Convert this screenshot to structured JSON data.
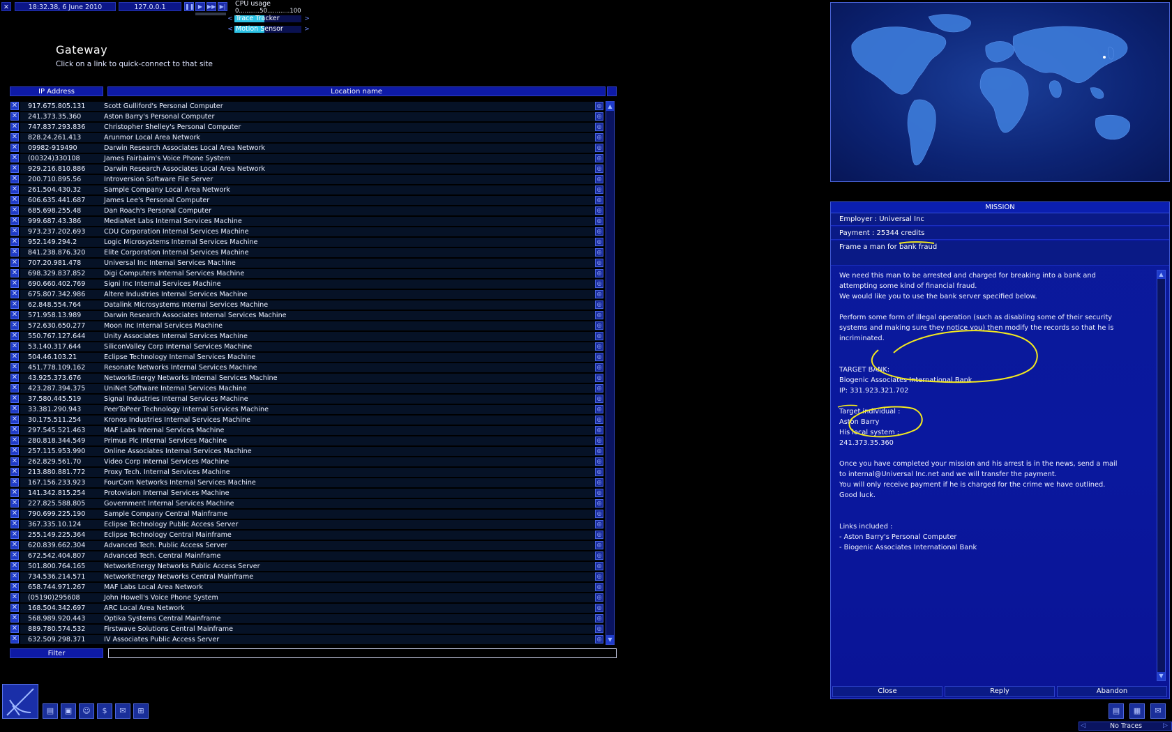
{
  "topbar": {
    "datetime": "18:32.38, 6 June 2010",
    "ip": "127.0.0.1",
    "cpu_label": "CPU usage",
    "cpu_scale": "0...........50............100",
    "bars": [
      {
        "label": "Trace Tracker",
        "fill": 0.45
      },
      {
        "label": "Motion Sensor",
        "fill": 0.45
      }
    ]
  },
  "gateway": {
    "title": "Gateway",
    "subtitle": "Click on a link to quick-connect to that site",
    "col_ip": "IP Address",
    "col_location": "Location name",
    "filter_label": "Filter",
    "filter_value": "",
    "rows": [
      {
        "ip": "917.675.805.131",
        "name": "Scott Gulliford's Personal Computer"
      },
      {
        "ip": "241.373.35.360",
        "name": "Aston Barry's Personal Computer"
      },
      {
        "ip": "747.837.293.836",
        "name": "Christopher Shelley's Personal Computer"
      },
      {
        "ip": "828.24.261.413",
        "name": "Arunmor Local Area Network"
      },
      {
        "ip": "09982-919490",
        "name": "Darwin Research Associates Local Area Network"
      },
      {
        "ip": "(00324)330108",
        "name": "James Fairbairn's Voice Phone System"
      },
      {
        "ip": "929.216.810.886",
        "name": "Darwin Research Associates Local Area Network"
      },
      {
        "ip": "200.710.895.56",
        "name": "Introversion Software File Server"
      },
      {
        "ip": "261.504.430.32",
        "name": "Sample Company Local Area Network"
      },
      {
        "ip": "606.635.441.687",
        "name": "James Lee's Personal Computer"
      },
      {
        "ip": "685.698.255.48",
        "name": "Dan Roach's Personal Computer"
      },
      {
        "ip": "999.687.43.386",
        "name": "MediaNet Labs Internal Services Machine"
      },
      {
        "ip": "973.237.202.693",
        "name": "CDU Corporation Internal Services Machine"
      },
      {
        "ip": "952.149.294.2",
        "name": "Logic Microsystems Internal Services Machine"
      },
      {
        "ip": "841.238.876.320",
        "name": "Elite Corporation Internal Services Machine"
      },
      {
        "ip": "707.20.981.478",
        "name": "Universal Inc Internal Services Machine"
      },
      {
        "ip": "698.329.837.852",
        "name": "Digi Computers Internal Services Machine"
      },
      {
        "ip": "690.660.402.769",
        "name": "Signi Inc Internal Services Machine"
      },
      {
        "ip": "675.807.342.986",
        "name": "Altere Industries Internal Services Machine"
      },
      {
        "ip": "62.848.554.764",
        "name": "Datalink Microsystems Internal Services Machine"
      },
      {
        "ip": "571.958.13.989",
        "name": "Darwin Research Associates Internal Services Machine"
      },
      {
        "ip": "572.630.650.277",
        "name": "Moon Inc Internal Services Machine"
      },
      {
        "ip": "550.767.127.644",
        "name": "Unity Associates Internal Services Machine"
      },
      {
        "ip": "53.140.317.644",
        "name": "SiliconValley Corp Internal Services Machine"
      },
      {
        "ip": "504.46.103.21",
        "name": "Eclipse Technology Internal Services Machine"
      },
      {
        "ip": "451.778.109.162",
        "name": "Resonate Networks Internal Services Machine"
      },
      {
        "ip": "43.925.373.676",
        "name": "NetworkEnergy Networks Internal Services Machine"
      },
      {
        "ip": "423.287.394.375",
        "name": "UniNet Software Internal Services Machine"
      },
      {
        "ip": "37.580.445.519",
        "name": "Signal Industries Internal Services Machine"
      },
      {
        "ip": "33.381.290.943",
        "name": "PeerToPeer Technology Internal Services Machine"
      },
      {
        "ip": "30.175.511.254",
        "name": "Kronos Industries Internal Services Machine"
      },
      {
        "ip": "297.545.521.463",
        "name": "MAF Labs Internal Services Machine"
      },
      {
        "ip": "280.818.344.549",
        "name": "Primus Plc Internal Services Machine"
      },
      {
        "ip": "257.115.953.990",
        "name": "Online Associates Internal Services Machine"
      },
      {
        "ip": "262.829.561.70",
        "name": "Video Corp Internal Services Machine"
      },
      {
        "ip": "213.880.881.772",
        "name": "Proxy Tech. Internal Services Machine"
      },
      {
        "ip": "167.156.233.923",
        "name": "FourCom Networks Internal Services Machine"
      },
      {
        "ip": "141.342.815.254",
        "name": "Protovision Internal Services Machine"
      },
      {
        "ip": "227.825.588.805",
        "name": "Government Internal Services Machine"
      },
      {
        "ip": "790.699.225.190",
        "name": "Sample Company Central Mainframe"
      },
      {
        "ip": "367.335.10.124",
        "name": "Eclipse Technology Public Access Server"
      },
      {
        "ip": "255.149.225.364",
        "name": "Eclipse Technology Central Mainframe"
      },
      {
        "ip": "620.839.662.304",
        "name": "Advanced Tech. Public Access Server"
      },
      {
        "ip": "672.542.404.807",
        "name": "Advanced Tech. Central Mainframe"
      },
      {
        "ip": "501.800.764.165",
        "name": "NetworkEnergy Networks Public Access Server"
      },
      {
        "ip": "734.536.214.571",
        "name": "NetworkEnergy Networks Central Mainframe"
      },
      {
        "ip": "658.744.971.267",
        "name": "MAF Labs Local Area Network"
      },
      {
        "ip": "(05190)295608",
        "name": "John Howell's Voice Phone System"
      },
      {
        "ip": "168.504.342.697",
        "name": "ARC Local Area Network"
      },
      {
        "ip": "568.989.920.443",
        "name": "Optika Systems Central Mainframe"
      },
      {
        "ip": "889.780.574.532",
        "name": "Firstwave Solutions Central Mainframe"
      },
      {
        "ip": "632.509.298.371",
        "name": "IV Associates Public Access Server"
      }
    ]
  },
  "mission": {
    "header": "MISSION",
    "employer": "Employer : Universal Inc",
    "payment": "Payment : 25344 credits",
    "description_prefix": "Frame a man for ",
    "description_highlight": "bank fraud",
    "body_lines": [
      "We need this man to be arrested and charged for breaking into a bank and",
      "attempting some kind of financial fraud.",
      "We would like you to use the bank server specified below.",
      "",
      "Perform some form of illegal operation (such as disabling some of their security",
      "systems and making sure they notice you) then modify the records so that he is",
      "incriminated.",
      "",
      "",
      "TARGET BANK:",
      "Biogenic Associates International Bank",
      "IP: 331.923.321.702",
      "",
      "Target individual :",
      "Aston Barry",
      "His local system :",
      "241.373.35.360",
      "",
      "Once you have completed your mission and his arrest is in the news, send a mail",
      "to internal@Universal Inc.net and we will transfer the payment.",
      "You will only receive payment if he is charged for the crime we have outlined.",
      "Good luck.",
      "",
      "",
      "Links included :",
      "- Aston Barry's Personal Computer",
      "- Biogenic Associates International Bank"
    ],
    "buttons": {
      "close": "Close",
      "reply": "Reply",
      "abandon": "Abandon"
    }
  },
  "statusbar": {
    "traces": "No Traces"
  },
  "colors": {
    "panel_blue": "#0a189e",
    "highlight_yellow": "#f4ea1e",
    "bar_cyan": "#2dc3e6"
  },
  "icons": [
    "close-icon",
    "pause-icon",
    "play-icon",
    "fast-forward-icon",
    "skip-icon",
    "connection-icon",
    "memory-icon",
    "hardware-icon",
    "finance-icon",
    "email-icon",
    "status-icon",
    "missions-icon",
    "log-icon",
    "send-icon",
    "info-icon"
  ]
}
